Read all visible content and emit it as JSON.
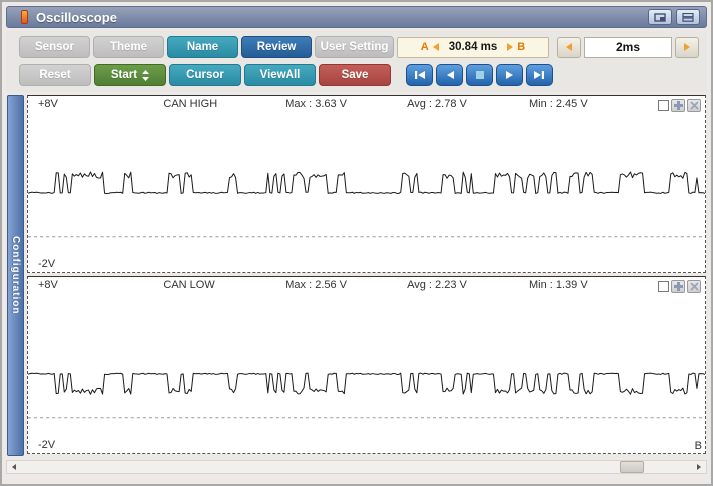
{
  "window": {
    "title": "Oscilloscope"
  },
  "icons": {
    "titlebar": [
      "app-icon",
      "window-restore-icon",
      "window-minimize-icon"
    ],
    "playback": [
      "skip-to-start-icon",
      "step-back-icon",
      "stop-icon",
      "play-icon",
      "skip-to-end-icon"
    ],
    "misc": [
      "spinner-updown-icon",
      "arrow-left-orange-icon",
      "arrow-right-orange-icon",
      "plus-icon",
      "close-x-icon"
    ]
  },
  "colors": {
    "titlebar_blue": "#6a7a9c",
    "button_gray": "#c5c5c5",
    "button_teal": "#2e9db3",
    "button_blue": "#2a62a0",
    "button_green": "#5a8c3c",
    "button_red": "#b04a46",
    "media_blue": "#2f79c2",
    "accent_orange": "#e07d00",
    "sidebar_blue": "#5b7fb4",
    "time_box_bg": "#fbf6e4",
    "wave_stroke": "#1a1a1a"
  },
  "toolbar": {
    "row1": [
      {
        "label": "Sensor"
      },
      {
        "label": "Theme"
      },
      {
        "label": "Name"
      },
      {
        "label": "Review"
      },
      {
        "label": "User Setting"
      }
    ],
    "row2": [
      {
        "label": "Reset"
      },
      {
        "label": "Start"
      },
      {
        "label": "Cursor"
      },
      {
        "label": "ViewAll"
      },
      {
        "label": "Save"
      }
    ],
    "time_range": {
      "a_label": "A",
      "value": "30.84 ms",
      "b_label": "B"
    },
    "timebase": {
      "value": "2ms"
    }
  },
  "sidebar": {
    "tab_label": "Configuration"
  },
  "panels": [
    {
      "top_label": "+8V",
      "name": "CAN HIGH",
      "max": "Max : 3.63 V",
      "avg": "Avg : 2.78 V",
      "min": "Min : 2.45 V",
      "bottom_label": "-2V",
      "corner_label": ""
    },
    {
      "top_label": "+8V",
      "name": "CAN LOW",
      "max": "Max : 2.56 V",
      "avg": "Avg : 2.23 V",
      "min": "Min : 1.39 V",
      "bottom_label": "-2V",
      "corner_label": "B"
    }
  ],
  "chart_data": [
    {
      "type": "line",
      "title": "CAN HIGH",
      "ylabel": "V",
      "ylim": [
        -2,
        8
      ],
      "grid": "single dashed zero line",
      "legend": "none",
      "baseline_v": 2.5,
      "max_v": 3.63,
      "avg_v": 2.78,
      "min_v": 2.45,
      "polarity": "up",
      "seed": 7,
      "timebase": "2ms/div",
      "window_span": "30.84 ms",
      "bursts": [
        [
          0.033,
          0.12
        ],
        [
          0.14,
          0.158
        ],
        [
          0.208,
          0.245
        ],
        [
          0.283,
          0.31
        ],
        [
          0.353,
          0.442
        ],
        [
          0.457,
          0.48
        ],
        [
          0.545,
          0.585
        ],
        [
          0.61,
          0.655
        ],
        [
          0.688,
          0.78
        ],
        [
          0.8,
          0.835
        ],
        [
          0.875,
          0.915
        ],
        [
          0.948,
          0.99
        ]
      ]
    },
    {
      "type": "line",
      "title": "CAN LOW",
      "ylabel": "V",
      "ylim": [
        -2,
        8
      ],
      "grid": "single dashed zero line",
      "legend": "none",
      "baseline_v": 2.5,
      "max_v": 2.56,
      "avg_v": 2.23,
      "min_v": 1.39,
      "polarity": "down",
      "seed": 7,
      "timebase": "2ms/div",
      "window_span": "30.84 ms",
      "bursts": [
        [
          0.033,
          0.12
        ],
        [
          0.14,
          0.158
        ],
        [
          0.208,
          0.245
        ],
        [
          0.283,
          0.31
        ],
        [
          0.353,
          0.442
        ],
        [
          0.457,
          0.48
        ],
        [
          0.545,
          0.585
        ],
        [
          0.61,
          0.655
        ],
        [
          0.688,
          0.78
        ],
        [
          0.8,
          0.835
        ],
        [
          0.875,
          0.915
        ],
        [
          0.948,
          0.99
        ]
      ]
    }
  ]
}
